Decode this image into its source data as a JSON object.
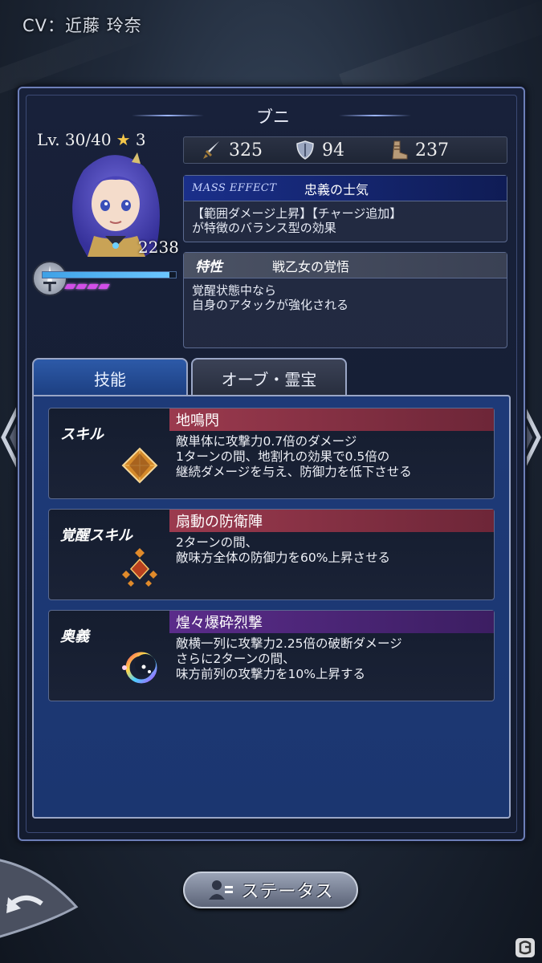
{
  "header": {
    "cv_text": "CV：近藤 玲奈"
  },
  "character": {
    "name": "ブニ",
    "level_text": "Lv. 30/40",
    "stars": "3",
    "hp": "2238",
    "hp_fill_fraction": 0.95,
    "awakening_gauge_segments": 4
  },
  "stats": {
    "attack": "325",
    "defense": "94",
    "speed": "237"
  },
  "mass_effect": {
    "label": "MASS EFFECT",
    "name": "忠義の士気",
    "desc_line1": "【範囲ダメージ上昇】【チャージ追加】",
    "desc_line2": "が特徴のバランス型の効果"
  },
  "trait": {
    "label": "特性",
    "name": "戦乙女の覚悟",
    "desc_line1": "覚醒状態中なら",
    "desc_line2": "自身のアタックが強化される"
  },
  "tabs": [
    {
      "label": "技能",
      "active": true
    },
    {
      "label": "オーブ・霊宝",
      "active": false
    }
  ],
  "skills": [
    {
      "type": "スキル",
      "name": "地鳴閃",
      "lines": [
        "敵単体に攻撃力0.7倍のダメージ",
        "1ターンの間、地割れの効果で0.5倍の",
        "継続ダメージを与え、防御力を低下させる"
      ]
    },
    {
      "type": "覚醒スキル",
      "name": "扇動の防衛陣",
      "lines": [
        "2ターンの間、",
        "敵味方全体の防御力を60%上昇させる"
      ]
    },
    {
      "type": "奥義",
      "name": "煌々爆砕烈撃",
      "lines": [
        "敵横一列に攻撃力2.25倍の破断ダメージ",
        "さらに2ターンの間、",
        "味方前列の攻撃力を10%上昇する"
      ]
    }
  ],
  "footer": {
    "status_button": "ステータス"
  },
  "colors": {
    "accent_blue": "#2d5aa8",
    "skill_red": "#9b3a4e",
    "skill_purple": "#5a2c8a",
    "gauge_pink": "#d24ee8"
  }
}
